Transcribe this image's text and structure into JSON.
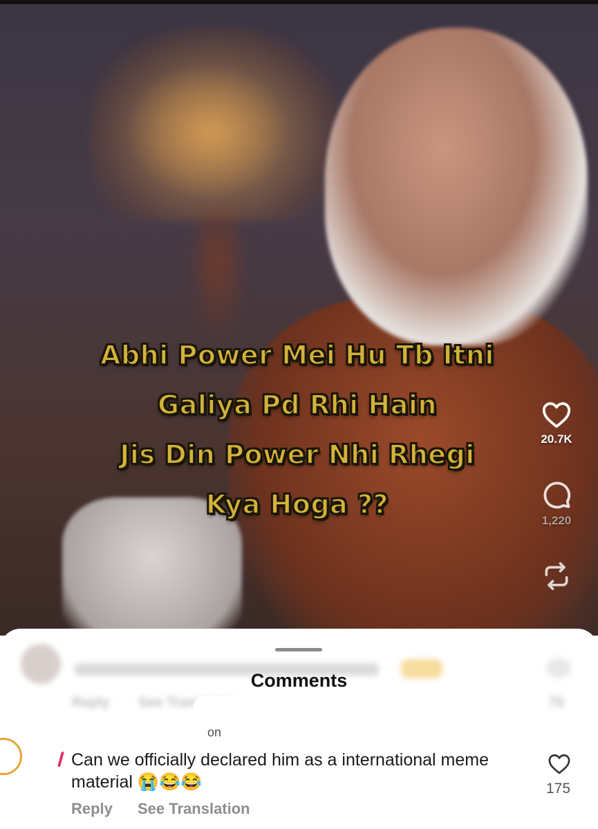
{
  "video": {
    "caption_lines": [
      "Abhi Power Mei Hu Tb Itni",
      "Galiya Pd Rhi Hain",
      "Jis Din Power Nhi Rhegi",
      "Kya Hoga ??"
    ],
    "likes": "20.7K",
    "comments_count": "1,220",
    "caption_color": "#d4b23a"
  },
  "sheet": {
    "title": "Comments",
    "blurred_comment": {
      "reply": "Reply",
      "see_translation": "See Translation",
      "likes": "70"
    },
    "comment": {
      "username_fragment": "on",
      "text": "Can we officially declared him as a international meme material 😭😂😂",
      "reply": "Reply",
      "see_translation": "See Translation",
      "likes": "175"
    }
  }
}
